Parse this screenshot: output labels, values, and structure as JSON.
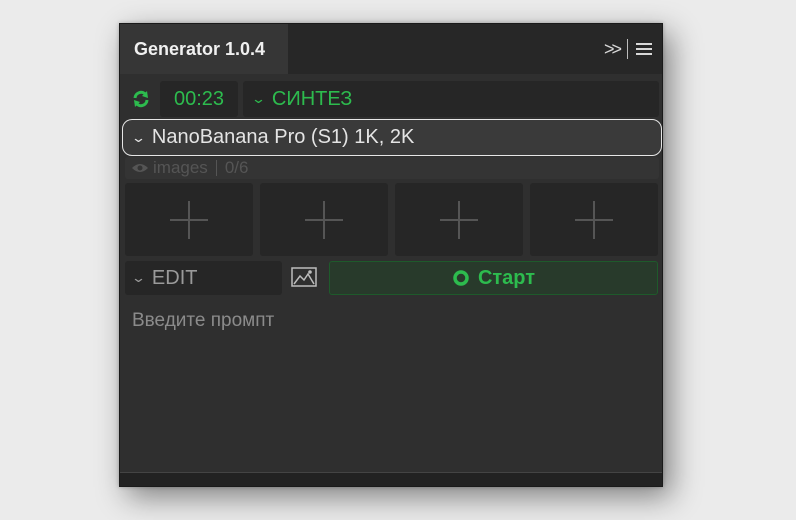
{
  "panel": {
    "tab_title": "Generator 1.0.4",
    "icons": {
      "expand": "double-chevron-right-icon",
      "menu": "hamburger-menu-icon"
    }
  },
  "top_row": {
    "refresh_icon": "refresh-icon",
    "timer": "00:23",
    "mode": "СИНТЕЗ"
  },
  "model": {
    "selected": "NanoBanana Pro (S1) 1K, 2K"
  },
  "images": {
    "label": "images",
    "count": "0/6",
    "icon": "eye-icon"
  },
  "slots": [
    {
      "icon": "plus-icon"
    },
    {
      "icon": "plus-icon"
    },
    {
      "icon": "plus-icon"
    },
    {
      "icon": "plus-icon"
    }
  ],
  "edit_row": {
    "mode": "EDIT",
    "image_icon": "image-icon",
    "start_label": "Старт",
    "start_icon": "circle-icon"
  },
  "prompt": {
    "placeholder": "Введите промпт"
  },
  "colors": {
    "accent_green": "#2dbb4e",
    "panel_bg": "#2f2f2f",
    "field_bg": "#262626"
  }
}
